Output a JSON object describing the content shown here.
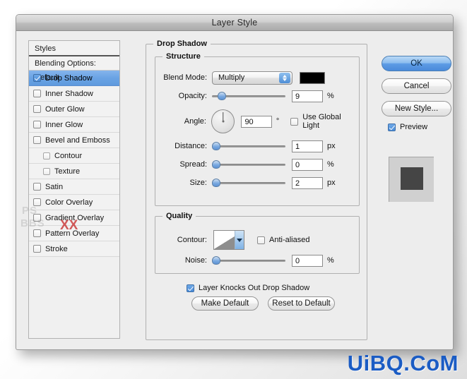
{
  "window": {
    "title": "Layer Style"
  },
  "styles_panel": {
    "header": "Styles",
    "blending_options": "Blending Options: Default",
    "items": [
      {
        "label": "Drop Shadow",
        "checked": true,
        "selected": true,
        "indent": false
      },
      {
        "label": "Inner Shadow",
        "checked": false,
        "selected": false,
        "indent": false
      },
      {
        "label": "Outer Glow",
        "checked": false,
        "selected": false,
        "indent": false
      },
      {
        "label": "Inner Glow",
        "checked": false,
        "selected": false,
        "indent": false
      },
      {
        "label": "Bevel and Emboss",
        "checked": false,
        "selected": false,
        "indent": false
      },
      {
        "label": "Contour",
        "checked": false,
        "selected": false,
        "indent": true
      },
      {
        "label": "Texture",
        "checked": false,
        "selected": false,
        "indent": true
      },
      {
        "label": "Satin",
        "checked": false,
        "selected": false,
        "indent": false
      },
      {
        "label": "Color Overlay",
        "checked": false,
        "selected": false,
        "indent": false
      },
      {
        "label": "Gradient Overlay",
        "checked": false,
        "selected": false,
        "indent": false
      },
      {
        "label": "Pattern Overlay",
        "checked": false,
        "selected": false,
        "indent": false
      },
      {
        "label": "Stroke",
        "checked": false,
        "selected": false,
        "indent": false
      }
    ]
  },
  "drop_shadow": {
    "group_title": "Drop Shadow",
    "structure": {
      "group_title": "Structure",
      "blend_mode_label": "Blend Mode:",
      "blend_mode_value": "Multiply",
      "shadow_color": "#000000",
      "opacity_label": "Opacity:",
      "opacity_value": "9",
      "opacity_unit": "%",
      "opacity_percent": 9,
      "angle_label": "Angle:",
      "angle_value": "90",
      "angle_unit": "°",
      "use_global_light_label": "Use Global Light",
      "use_global_light_checked": false,
      "distance_label": "Distance:",
      "distance_value": "1",
      "distance_unit": "px",
      "distance_percent": 4,
      "spread_label": "Spread:",
      "spread_value": "0",
      "spread_unit": "%",
      "spread_percent": 2,
      "size_label": "Size:",
      "size_value": "2",
      "size_unit": "px",
      "size_percent": 3
    },
    "quality": {
      "group_title": "Quality",
      "contour_label": "Contour:",
      "anti_aliased_label": "Anti-aliased",
      "anti_aliased_checked": false,
      "noise_label": "Noise:",
      "noise_value": "0",
      "noise_unit": "%",
      "noise_percent": 2
    },
    "knockout_label": "Layer Knocks Out Drop Shadow",
    "knockout_checked": true,
    "make_default_label": "Make Default",
    "reset_to_default_label": "Reset to Default"
  },
  "actions": {
    "ok_label": "OK",
    "cancel_label": "Cancel",
    "new_style_label": "New Style...",
    "preview_label": "Preview",
    "preview_checked": true
  },
  "watermarks": {
    "bottom_right": "UiBQ.CoM",
    "ghost_line1": "PS",
    "ghost_line2": "BBS",
    "ghost_mark": "XX"
  },
  "colors": {
    "accent_blue": "#5d9ce5",
    "selection_blue": "#6aa3e4",
    "watermark_blue": "#1b5cc4",
    "dialog_bg": "#ededed",
    "shadow_swatch": "#000000"
  }
}
